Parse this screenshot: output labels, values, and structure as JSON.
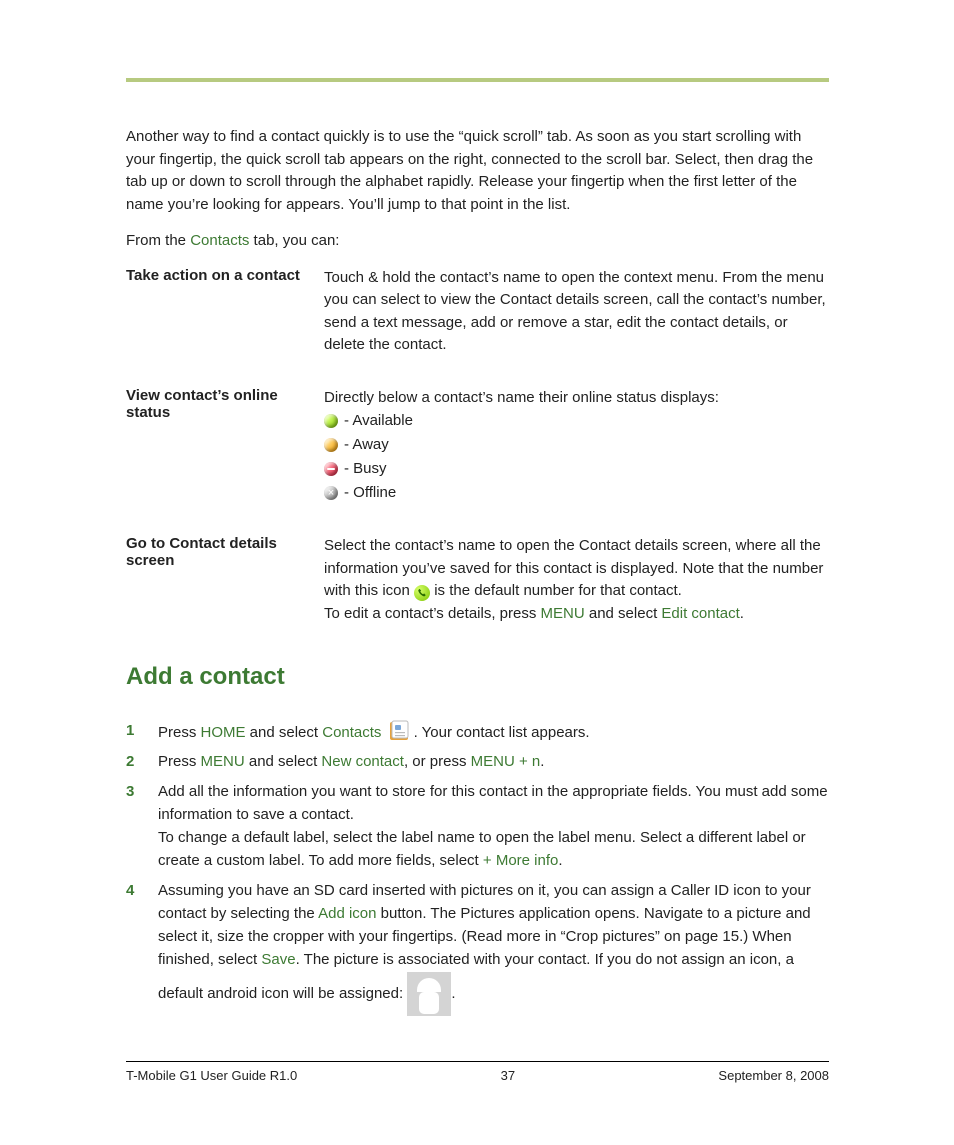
{
  "intro": "Another way to find a contact quickly is to use the “quick scroll” tab. As soon as you start scrolling with your fingertip, the quick scroll tab appears on the right, connected to the scroll bar. Select, then drag the tab up or down to scroll through the alphabet rapidly. Release your fingertip when the first letter of the name you’re looking for appears. You’ll jump to that point in the list.",
  "from_line_pre": "From the ",
  "from_line_link": "Contacts",
  "from_line_post": " tab, you can:",
  "defs": {
    "row1_term": "Take action on a contact",
    "row1_desc": "Touch & hold the contact’s name to open the context menu. From the menu you can select to view the Contact details screen, call the contact’s number, send a text message, add or remove a star, edit the contact details, or delete the contact.",
    "row2_term": "View contact’s online status",
    "row2_desc_lead": "Directly below a contact’s name their online status displays:",
    "row2_available": " - Available",
    "row2_away": " - Away",
    "row2_busy": " - Busy",
    "row2_offline": " - Offline",
    "row3_term": "Go to Contact details screen",
    "row3_p1_a": "Select the contact’s name to open the Contact details screen, where all the information you’ve saved for this contact is displayed. Note that the number with this icon ",
    "row3_p1_b": " is the default number for that contact.",
    "row3_p2_a": "To edit a contact’s details, press ",
    "row3_p2_menu": "MENU",
    "row3_p2_b": " and select ",
    "row3_p2_edit": "Edit contact",
    "row3_p2_c": "."
  },
  "heading": "Add a contact",
  "steps": {
    "s1_num": "1",
    "s1_a": "Press ",
    "s1_home": "HOME",
    "s1_b": " and select ",
    "s1_contacts": "Contacts",
    "s1_c": "  ",
    "s1_d": ". Your contact list appears.",
    "s2_num": "2",
    "s2_a": "Press ",
    "s2_menu": "MENU",
    "s2_b": " and select ",
    "s2_new": "New contact",
    "s2_c": ", or press ",
    "s2_combo": "MENU + n",
    "s2_d": ".",
    "s3_num": "3",
    "s3_p1": "Add all the information you want to store for this contact in the appropriate fields. You must add some information to save a contact.",
    "s3_p2_a": "To change a default label, select the label name to open the label menu. Select a different label or create a custom label. To add more fields, select ",
    "s3_p2_more": "+ More info",
    "s3_p2_b": ".",
    "s4_num": "4",
    "s4_a": "Assuming you have an SD card inserted with pictures on it, you can assign a Caller ID icon to your contact by selecting the ",
    "s4_addicon": "Add icon",
    "s4_b": " button. The Pictures application opens. Navigate to a picture and select it, size the cropper with your fingertips. (Read more in “Crop pictures” on page 15.) When finished, select ",
    "s4_save": "Save",
    "s4_c": ". The picture is associated with your contact. If you do not assign an icon, a default android icon will be assigned:   ",
    "s4_d": "."
  },
  "footer": {
    "left": "T-Mobile G1 User Guide R1.0",
    "center": "37",
    "right": "September 8, 2008"
  }
}
